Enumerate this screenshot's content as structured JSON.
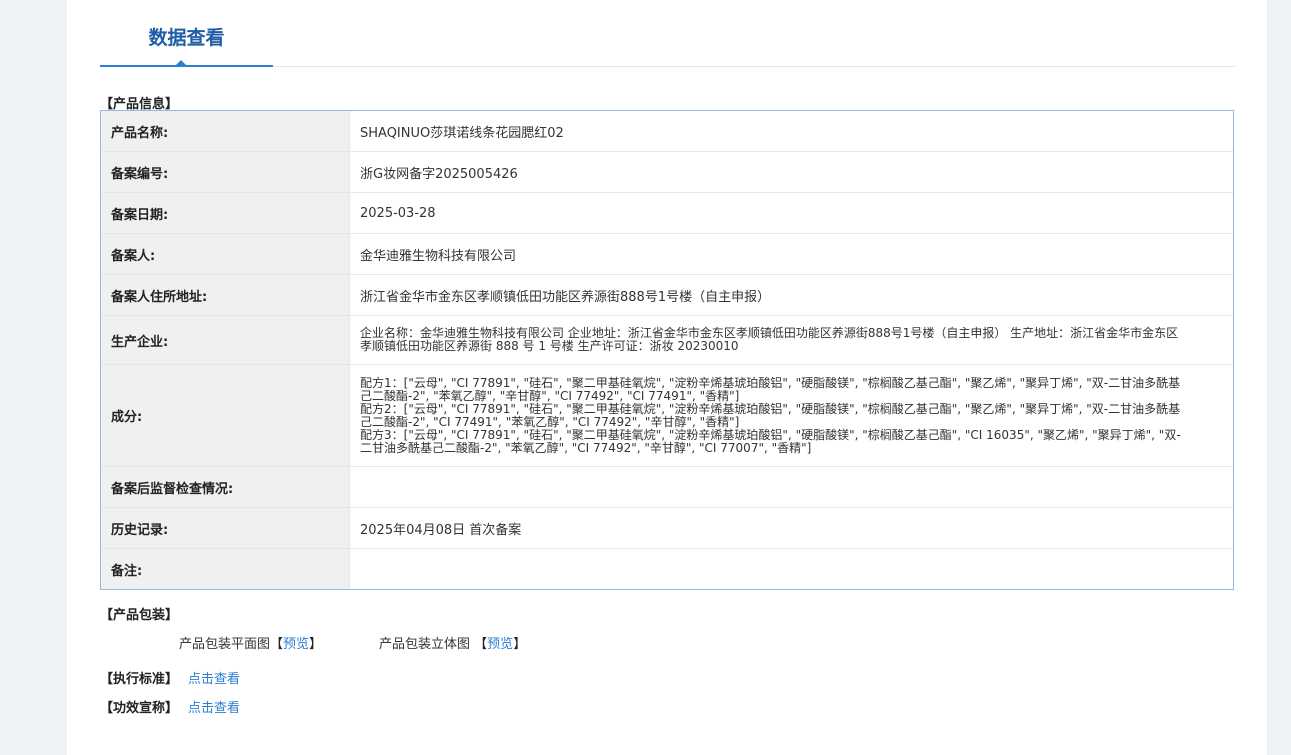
{
  "tab": {
    "label": "数据查看"
  },
  "sections": {
    "product_info": "【产品信息】",
    "packaging": "【产品包装】"
  },
  "info_rows": [
    {
      "label": "产品名称:",
      "value": "SHAQINUO莎琪诺线条花园腮红02"
    },
    {
      "label": "备案编号:",
      "value": "浙G妆网备字2025005426"
    },
    {
      "label": "备案日期:",
      "value": "2025-03-28"
    },
    {
      "label": "备案人:",
      "value": "金华迪雅生物科技有限公司"
    },
    {
      "label": "备案人住所地址:",
      "value": "浙江省金华市金东区孝顺镇低田功能区养源街888号1号楼（自主申报）"
    },
    {
      "label": "生产企业:",
      "value": "企业名称：金华迪雅生物科技有限公司 企业地址：浙江省金华市金东区孝顺镇低田功能区养源街888号1号楼（自主申报） 生产地址：浙江省金华市金东区孝顺镇低田功能区养源街 888 号 1 号楼 生产许可证：浙妆 20230010"
    },
    {
      "label": "成分:",
      "value": "配方1：[\"云母\", \"CI 77891\", \"硅石\", \"聚二甲基硅氧烷\", \"淀粉辛烯基琥珀酸铝\", \"硬脂酸镁\", \"棕榈酸乙基己酯\", \"聚乙烯\", \"聚异丁烯\", \"双-二甘油多酰基己二酸酯-2\", \"苯氧乙醇\", \"辛甘醇\", \"CI 77492\", \"CI 77491\", \"香精\"]\n配方2：[\"云母\", \"CI 77891\", \"硅石\", \"聚二甲基硅氧烷\", \"淀粉辛烯基琥珀酸铝\", \"硬脂酸镁\", \"棕榈酸乙基己酯\", \"聚乙烯\", \"聚异丁烯\", \"双-二甘油多酰基己二酸酯-2\", \"CI 77491\", \"苯氧乙醇\", \"CI 77492\", \"辛甘醇\", \"香精\"]\n配方3：[\"云母\", \"CI 77891\", \"硅石\", \"聚二甲基硅氧烷\", \"淀粉辛烯基琥珀酸铝\", \"硬脂酸镁\", \"棕榈酸乙基己酯\", \"CI 16035\", \"聚乙烯\", \"聚异丁烯\", \"双-二甘油多酰基己二酸酯-2\", \"苯氧乙醇\", \"CI 77492\", \"辛甘醇\", \"CI 77007\", \"香精\"]"
    },
    {
      "label": "备案后监督检查情况:",
      "value": ""
    },
    {
      "label": "历史记录:",
      "value": "2025年04月08日 首次备案"
    },
    {
      "label": "备注:",
      "value": ""
    }
  ],
  "packaging": {
    "flat_label": "产品包装平面图",
    "solid_label": "产品包装立体图",
    "preview": "预览",
    "open": "【",
    "close": "】"
  },
  "standards": {
    "exec_label": "【执行标准】",
    "efficacy_label": "【功效宣称】",
    "view_link": "点击查看"
  }
}
